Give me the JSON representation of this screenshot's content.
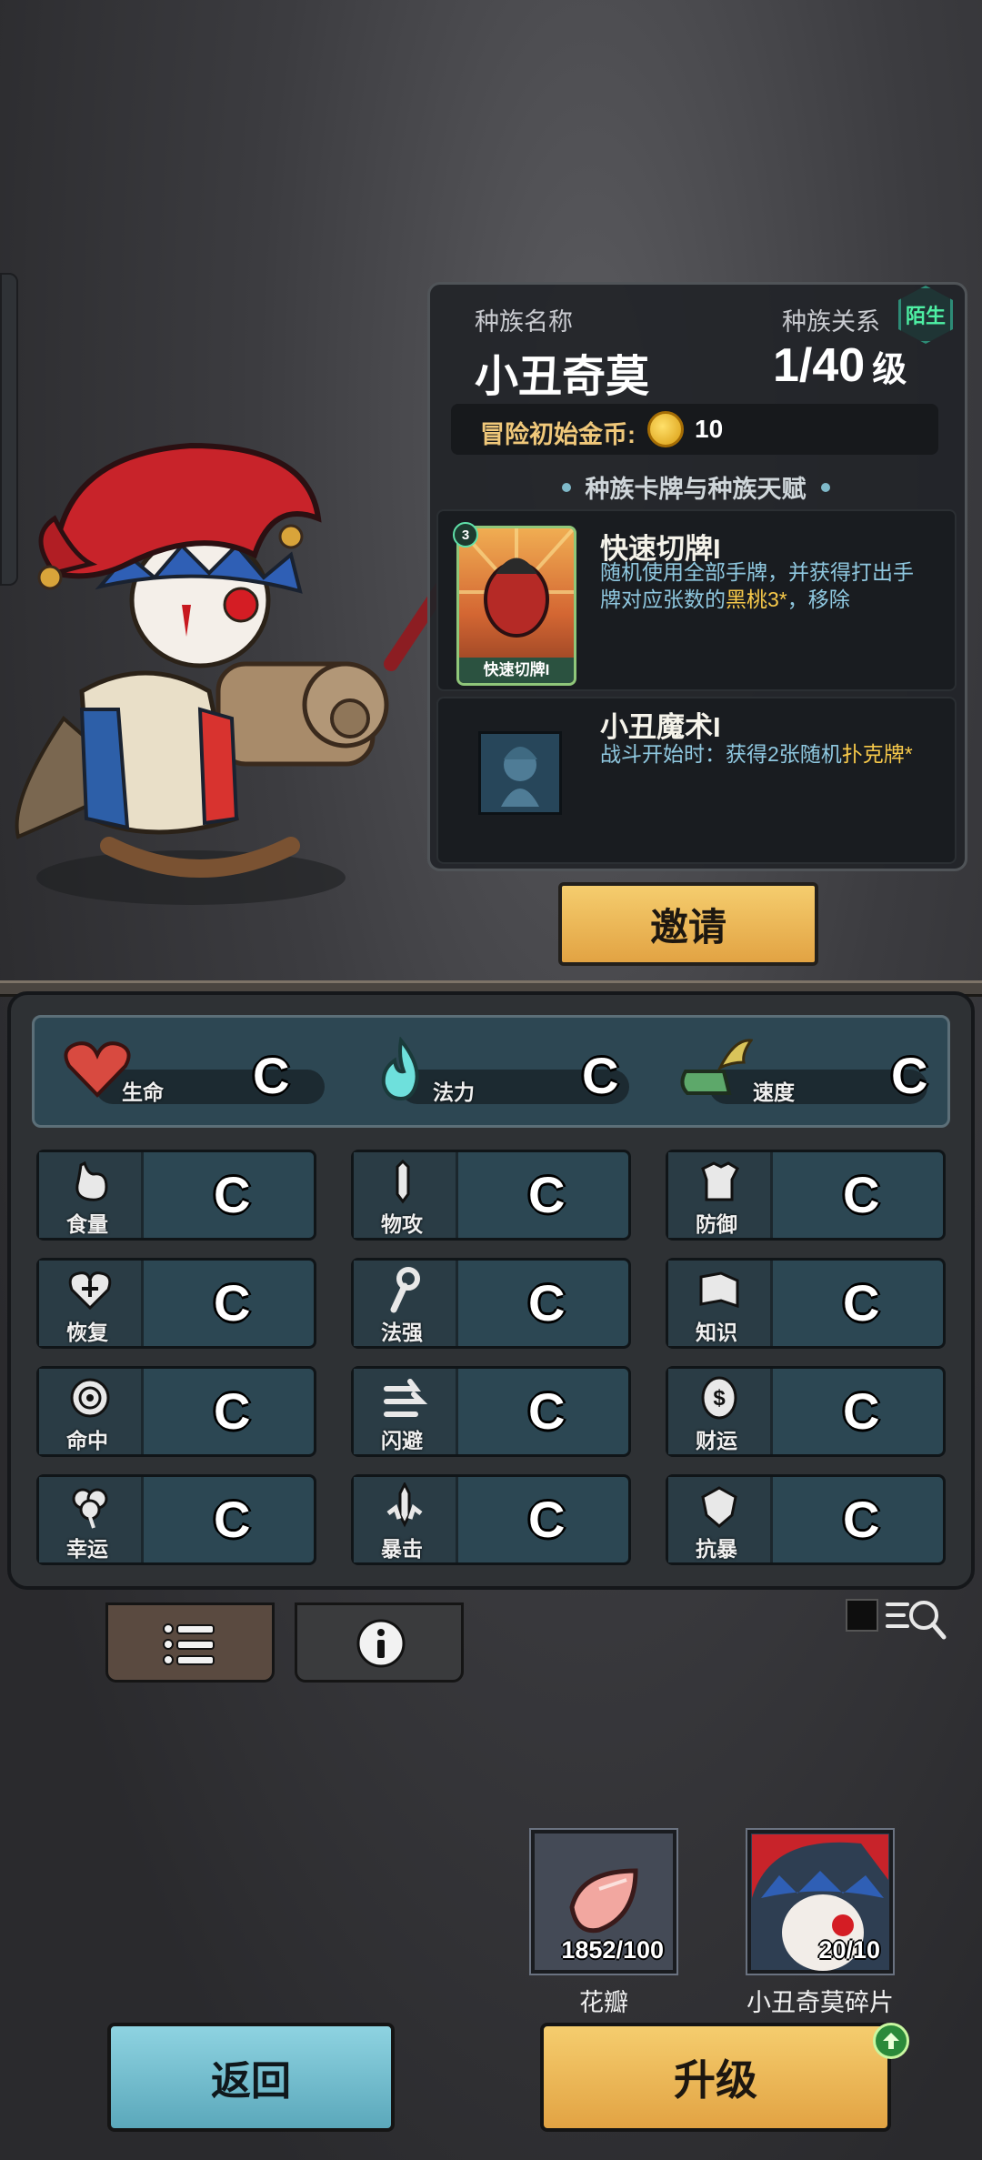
{
  "race": {
    "name_label": "种族名称",
    "name": "小丑奇莫",
    "relation_label": "种族关系",
    "relation_badge": "陌生",
    "level": "1/40",
    "level_suffix": "级",
    "start_gold_label": "冒险初始金币:",
    "start_gold_value": "10",
    "section_title": "种族卡牌与种族天赋"
  },
  "cards": [
    {
      "cost": "3",
      "art_label": "快速切牌I",
      "title": "快速切牌I",
      "desc_line1": "随机使用全部手牌，并获得打出手",
      "desc_line2_a": "牌对应张数的",
      "desc_line2_hl": "黑桃3*",
      "desc_line2_b": "，移除"
    },
    {
      "title": "小丑魔术I",
      "desc_a": "战斗开始时：获得2张随机",
      "desc_hl": "扑克牌*"
    }
  ],
  "invite_label": "邀请",
  "main_stats": [
    {
      "label": "生命",
      "grade": "C",
      "icon": "heart-icon"
    },
    {
      "label": "法力",
      "grade": "C",
      "icon": "mana-flame-icon"
    },
    {
      "label": "速度",
      "grade": "C",
      "icon": "winged-boot-icon"
    }
  ],
  "stats": [
    {
      "label": "食量",
      "grade": "C",
      "icon": "stomach-icon"
    },
    {
      "label": "物攻",
      "grade": "C",
      "icon": "sword-icon"
    },
    {
      "label": "防御",
      "grade": "C",
      "icon": "armor-icon"
    },
    {
      "label": "恢复",
      "grade": "C",
      "icon": "heart-plus-icon"
    },
    {
      "label": "法强",
      "grade": "C",
      "icon": "staff-icon"
    },
    {
      "label": "知识",
      "grade": "C",
      "icon": "book-icon"
    },
    {
      "label": "命中",
      "grade": "C",
      "icon": "target-icon"
    },
    {
      "label": "闪避",
      "grade": "C",
      "icon": "dodge-arrows-icon"
    },
    {
      "label": "财运",
      "grade": "C",
      "icon": "coin-icon"
    },
    {
      "label": "幸运",
      "grade": "C",
      "icon": "clover-icon"
    },
    {
      "label": "暴击",
      "grade": "C",
      "icon": "crit-sword-icon"
    },
    {
      "label": "抗暴",
      "grade": "C",
      "icon": "shield-icon"
    }
  ],
  "materials": [
    {
      "name": "花瓣",
      "count": "1852/100",
      "icon": "petal-icon"
    },
    {
      "name": "小丑奇莫碎片",
      "count": "20/10",
      "icon": "clown-portrait-icon"
    }
  ],
  "back_label": "返回",
  "upgrade_label": "升级",
  "colors": {
    "accent_gold": "#e9ad4a",
    "accent_blue": "#6bbccd",
    "relation_green": "#4ef0a4",
    "highlight_yellow": "#f7c94a",
    "desc_blue": "#8fc8e0"
  }
}
